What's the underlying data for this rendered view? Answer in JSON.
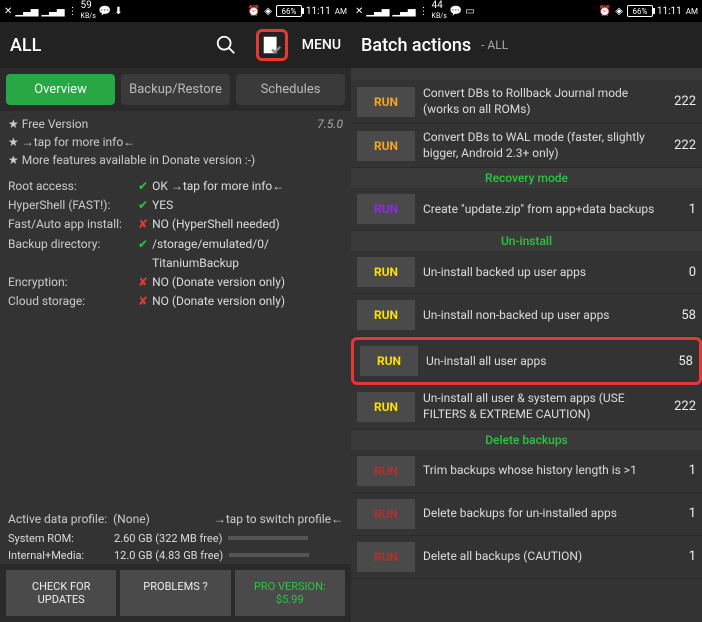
{
  "status": {
    "net_speed_left": "59",
    "net_unit_left": "KB/s",
    "net_speed_right": "44",
    "net_unit_right": "KB/s",
    "battery": "66%",
    "time": "11:11",
    "ampm": "AM"
  },
  "left": {
    "title": "ALL",
    "menu": "MENU",
    "tabs": {
      "overview": "Overview",
      "backup": "Backup/Restore",
      "schedules": "Schedules"
    },
    "info": {
      "free": "★ Free Version",
      "version": "7.5.0",
      "tap": "★  →tap for more info←",
      "donate": "★ More features available in Donate version :-)"
    },
    "rows": {
      "root_k": "Root access:",
      "root_v": "OK →tap for more info←",
      "hyper_k": "HyperShell (FAST!):",
      "hyper_v": "YES",
      "fast_k": "Fast/Auto app install:",
      "fast_v": "NO (HyperShell needed)",
      "backup_k": "Backup directory:",
      "backup_v": "/storage/emulated/0/\nTitaniumBackup",
      "enc_k": "Encryption:",
      "enc_v": "NO (Donate version only)",
      "cloud_k": "Cloud storage:",
      "cloud_v": "NO (Donate version only)"
    },
    "profile": {
      "k": "Active data profile:",
      "v": "(None)",
      "hint": "→tap to switch profile←"
    },
    "storage": {
      "sys_k": "System ROM:",
      "sys_v": "2.60 GB (322 MB free)",
      "int_k": "Internal+Media:",
      "int_v": "12.0 GB (4.83 GB free)"
    },
    "buttons": {
      "check": "CHECK FOR\nUPDATES",
      "problems": "PROBLEMS ?",
      "pro": "PRO VERSION:\n$5.99"
    }
  },
  "right": {
    "title": "Batch actions",
    "sub": "- ALL",
    "headers": {
      "recovery": "Recovery mode",
      "uninstall": "Un-install",
      "delete": "Delete backups"
    },
    "run": "RUN",
    "rows": {
      "r1": {
        "desc": "Convert DBs to Rollback Journal mode (works on all ROMs)",
        "n": "222"
      },
      "r2": {
        "desc": "Convert DBs to WAL mode (faster, slightly bigger, Android 2.3+ only)",
        "n": "222"
      },
      "r3": {
        "desc": "Create \"update.zip\" from app+data backups",
        "n": "1"
      },
      "r4": {
        "desc": "Un-install backed up user apps",
        "n": "0"
      },
      "r5": {
        "desc": "Un-install non-backed up user apps",
        "n": "58"
      },
      "r6": {
        "desc": "Un-install all user apps",
        "n": "58"
      },
      "r7": {
        "desc": "Un-install all user & system apps (USE FILTERS & EXTREME CAUTION)",
        "n": "222"
      },
      "r8": {
        "desc": "Trim backups whose history length is >1",
        "n": "1"
      },
      "r9": {
        "desc": "Delete backups for un-installed apps",
        "n": "1"
      },
      "r10": {
        "desc": "Delete all backups (CAUTION)",
        "n": "1"
      }
    }
  }
}
